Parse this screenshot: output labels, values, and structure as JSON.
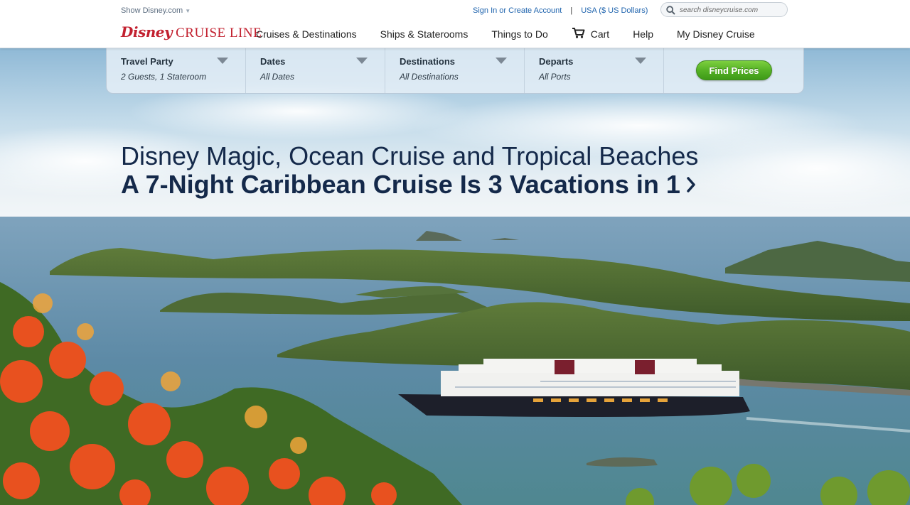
{
  "header": {
    "show_disney": "Show Disney.com",
    "sign_in": "Sign In or Create Account",
    "separator": "|",
    "currency": "USA ($ US Dollars)",
    "search_placeholder": "search disneycruise.com",
    "logo_word1": "Disney",
    "logo_word2": "CRUISE LINE"
  },
  "nav": {
    "items": [
      {
        "label": "Cruises & Destinations"
      },
      {
        "label": "Ships & Staterooms"
      },
      {
        "label": "Things to Do"
      },
      {
        "label": "Cart",
        "icon": "cart-icon"
      },
      {
        "label": "Help"
      },
      {
        "label": "My Disney Cruise"
      }
    ]
  },
  "filters": [
    {
      "label": "Travel Party",
      "value": "2 Guests, 1 Stateroom"
    },
    {
      "label": "Dates",
      "value": "All Dates"
    },
    {
      "label": "Destinations",
      "value": "All Destinations"
    },
    {
      "label": "Departs",
      "value": "All Ports"
    }
  ],
  "find_prices": "Find Prices",
  "hero": {
    "line1": "Disney Magic, Ocean Cruise and Tropical Beaches",
    "line2": "A 7-Night Caribbean Cruise Is 3 Vacations in 1"
  },
  "colors": {
    "brand_red": "#c2202f",
    "link_blue": "#1e63ad",
    "headline_navy": "#14294a",
    "button_green": "#56b226"
  }
}
